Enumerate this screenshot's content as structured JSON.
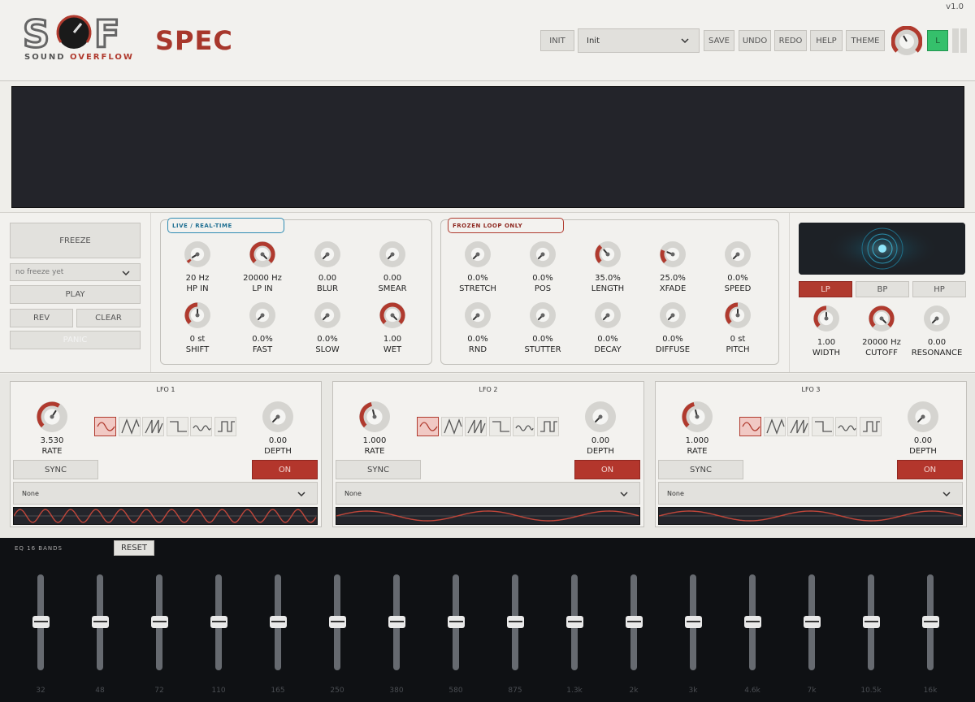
{
  "app": {
    "version": "v1.0",
    "logo_text": "SOUND",
    "logo_text_accent": "OVERFLOW",
    "product": "SPEC"
  },
  "toolbar": {
    "init_label": "INIT",
    "preset_value": "Init",
    "save_label": "SAVE",
    "undo_label": "UNDO",
    "redo_label": "REDO",
    "help_label": "HELP",
    "theme_label": "THEME",
    "l_label": "L"
  },
  "freeze_panel": {
    "freeze_label": "FREEZE",
    "freeze_select_placeholder": "no freeze yet",
    "play_label": "PLAY",
    "rev_label": "REV",
    "clear_label": "CLEAR",
    "panic_label": "PANIC"
  },
  "live": {
    "tag": "LIVE / REAL-TIME",
    "knobs": [
      {
        "value": "20 Hz",
        "label": "HP IN",
        "level": 0.05
      },
      {
        "value": "20000 Hz",
        "label": "LP IN",
        "level": 1.0
      },
      {
        "value": "0.00",
        "label": "BLUR",
        "level": 0.0
      },
      {
        "value": "0.00",
        "label": "SMEAR",
        "level": 0.0
      },
      {
        "value": "0 st",
        "label": "SHIFT",
        "level": 0.5
      },
      {
        "value": "0.0%",
        "label": "FAST",
        "level": 0.0
      },
      {
        "value": "0.0%",
        "label": "SLOW",
        "level": 0.0
      },
      {
        "value": "1.00",
        "label": "WET",
        "level": 1.0
      }
    ]
  },
  "frozen": {
    "tag": "FROZEN LOOP ONLY",
    "knobs": [
      {
        "value": "0.0%",
        "label": "STRETCH",
        "level": 0.0
      },
      {
        "value": "0.0%",
        "label": "POS",
        "level": 0.0
      },
      {
        "value": "35.0%",
        "label": "LENGTH",
        "level": 0.35
      },
      {
        "value": "25.0%",
        "label": "XFADE",
        "level": 0.25
      },
      {
        "value": "0.0%",
        "label": "SPEED",
        "level": 0.0
      },
      {
        "value": "0.0%",
        "label": "RND",
        "level": 0.0
      },
      {
        "value": "0.0%",
        "label": "STUTTER",
        "level": 0.0
      },
      {
        "value": "0.0%",
        "label": "DECAY",
        "level": 0.0
      },
      {
        "value": "0.0%",
        "label": "DIFFUSE",
        "level": 0.0
      },
      {
        "value": "0 st",
        "label": "PITCH",
        "level": 0.5
      }
    ]
  },
  "filter": {
    "modes": [
      "LP",
      "BP",
      "HP"
    ],
    "selected_mode": "LP",
    "knobs": [
      {
        "value": "1.00",
        "label": "WIDTH",
        "level": 0.5
      },
      {
        "value": "20000 Hz",
        "label": "CUTOFF",
        "level": 1.0
      },
      {
        "value": "0.00",
        "label": "RESONANCE",
        "level": 0.0
      }
    ]
  },
  "lfos": [
    {
      "title": "LFO 1",
      "rate_value": "3.530",
      "rate_label": "RATE",
      "rate_level": 0.62,
      "depth_value": "0.00",
      "depth_label": "DEPTH",
      "depth_level": 0.0,
      "sync_label": "SYNC",
      "on_label": "ON",
      "target": "None",
      "cycles": 12
    },
    {
      "title": "LFO 2",
      "rate_value": "1.000",
      "rate_label": "RATE",
      "rate_level": 0.45,
      "depth_value": "0.00",
      "depth_label": "DEPTH",
      "depth_level": 0.0,
      "sync_label": "SYNC",
      "on_label": "ON",
      "target": "None",
      "cycles": 2.5
    },
    {
      "title": "LFO 3",
      "rate_value": "1.000",
      "rate_label": "RATE",
      "rate_level": 0.45,
      "depth_value": "0.00",
      "depth_label": "DEPTH",
      "depth_level": 0.0,
      "sync_label": "SYNC",
      "on_label": "ON",
      "target": "None",
      "cycles": 2.5
    }
  ],
  "eq": {
    "label": "EQ  16  BANDS",
    "reset_label": "RESET",
    "bands": [
      "32",
      "48",
      "72",
      "110",
      "165",
      "250",
      "380",
      "580",
      "875",
      "1.3k",
      "2k",
      "3k",
      "4.6k",
      "7k",
      "10.5k",
      "16k"
    ],
    "gains_db": [
      0,
      0,
      0,
      0,
      0,
      0,
      0,
      0,
      0,
      0,
      0,
      0,
      0,
      0,
      0,
      0
    ]
  },
  "colors": {
    "accent": "#b03a2e",
    "active_green": "#35c06b",
    "live_tag": "#2f8cb3",
    "frozen_tag": "#b03a2e"
  }
}
